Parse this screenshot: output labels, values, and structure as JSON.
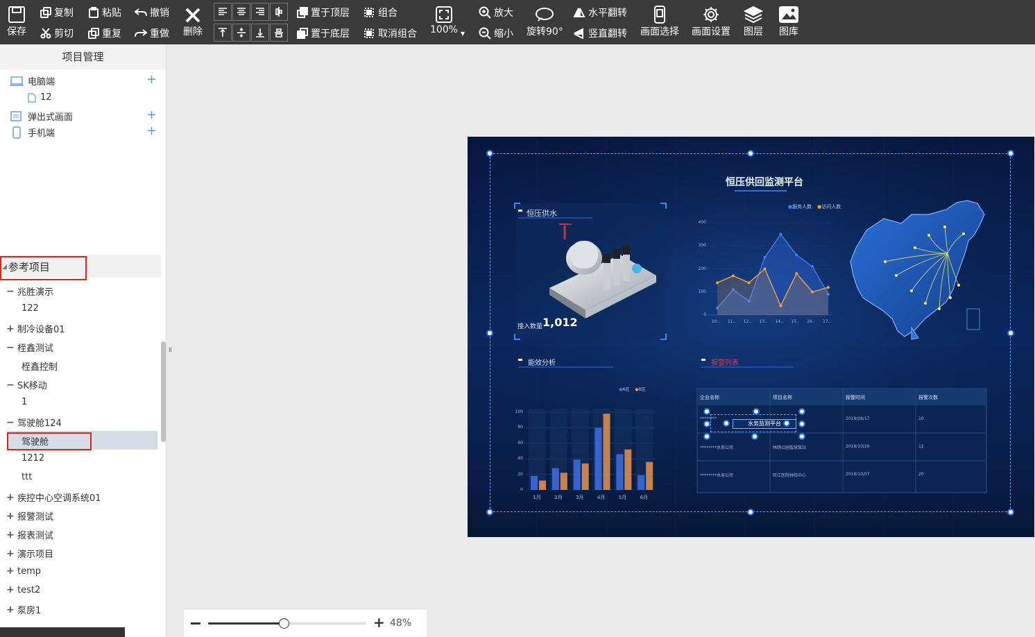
{
  "toolbar": {
    "save": "保存",
    "copy": "复制",
    "cut": "剪切",
    "paste": "粘贴",
    "repeat": "重复",
    "undo": "撤销",
    "redo": "重做",
    "delete": "删除",
    "bring_front": "置于顶层",
    "send_back": "置于底层",
    "group": "组合",
    "ungroup": "取消组合",
    "zoom_level": "100%",
    "zoom_in": "放大",
    "zoom_out": "缩小",
    "rotate": "旋转90°",
    "flip_h": "水平翻转",
    "flip_v": "竖直翻转",
    "screen_select": "画面选择",
    "screen_settings": "画面设置",
    "layers": "图层",
    "gallery": "图库"
  },
  "sidebar": {
    "title": "项目管理",
    "project_items": [
      {
        "label": "电脑端",
        "icon": "monitor-icon"
      },
      {
        "label": "12",
        "icon": "file-icon"
      },
      {
        "label": "弹出式画面",
        "icon": "popup-icon"
      },
      {
        "label": "手机端",
        "icon": "phone-icon"
      }
    ],
    "reference_header": "参考项目",
    "reference_items": [
      {
        "mark": "−",
        "label": "兆胜演示"
      },
      {
        "mark": "",
        "label": "122"
      },
      {
        "mark": "+",
        "label": "制冷设备01"
      },
      {
        "mark": "−",
        "label": "桎鑫测试"
      },
      {
        "mark": "",
        "label": "桎鑫控制"
      },
      {
        "mark": "−",
        "label": "SK移动"
      },
      {
        "mark": "",
        "label": "1"
      },
      {
        "mark": "−",
        "label": "驾驶舱124"
      },
      {
        "mark": "",
        "label": "驾驶舱"
      },
      {
        "mark": "",
        "label": "1212"
      },
      {
        "mark": "",
        "label": "ttt"
      },
      {
        "mark": "+",
        "label": "疾控中心空调系统01"
      },
      {
        "mark": "+",
        "label": "报警测试"
      },
      {
        "mark": "+",
        "label": "报表测试"
      },
      {
        "mark": "+",
        "label": "演示项目"
      },
      {
        "mark": "+",
        "label": "temp"
      },
      {
        "mark": "+",
        "label": "test2"
      },
      {
        "mark": "+",
        "label": "泵房1"
      }
    ]
  },
  "canvas": {
    "main_title": "恒压供回监测平台",
    "panel1_title": "恒压供水",
    "access_label": "接入数量",
    "access_value": "1,012",
    "line_legend": [
      "服务人数",
      "访问人数"
    ],
    "line_y_ticks": [
      "400",
      "300",
      "200",
      "100",
      "0"
    ],
    "line_x_ticks": [
      "10..",
      "11..",
      "12..",
      "13..",
      "14..",
      "15..",
      "16..",
      "17.."
    ],
    "panel3_title": "能效分析",
    "bar_legend": [
      "A区",
      "B区"
    ],
    "bar_y_ticks": [
      "100",
      "80",
      "60",
      "40",
      "20",
      "0"
    ],
    "bar_x_ticks": [
      "1月",
      "2月",
      "3月",
      "4月",
      "5月",
      "6月"
    ],
    "panel4_title": "报警列表",
    "table_headers": [
      "企业名称",
      "项目名称",
      "报警时间",
      "报警次数"
    ],
    "table_rows": [
      [
        "********",
        "水务监测平台",
        "2018/08/17",
        "10"
      ],
      [
        "********水务公司",
        "林荫公园智慧泵站",
        "2018/10/26",
        "12"
      ],
      [
        "********水务公司",
        "旺江医院林校中心",
        "2018/10/07",
        "20"
      ]
    ],
    "selected_text": "水务监测平台"
  },
  "zoom": {
    "percent": "48%",
    "value": 0.48
  },
  "chart_data": [
    {
      "type": "line",
      "x": [
        "10..",
        "11..",
        "12..",
        "13..",
        "14..",
        "15..",
        "16..",
        "17.."
      ],
      "series": [
        {
          "name": "服务人数",
          "values": [
            30,
            110,
            60,
            250,
            350,
            260,
            210,
            90
          ]
        },
        {
          "name": "访问人数",
          "values": [
            140,
            170,
            140,
            200,
            40,
            180,
            100,
            120
          ]
        }
      ],
      "ylim": [
        0,
        400
      ],
      "colors": [
        "#3b7bff",
        "#f2a23c"
      ]
    },
    {
      "type": "bar",
      "categories": [
        "1月",
        "2月",
        "3月",
        "4月",
        "5月",
        "6月"
      ],
      "series": [
        {
          "name": "A区",
          "values": [
            18,
            28,
            39,
            80,
            46,
            19
          ]
        },
        {
          "name": "B区",
          "values": [
            12,
            22,
            34,
            98,
            52,
            36
          ]
        }
      ],
      "ylim": [
        0,
        100
      ],
      "colors": [
        "#3b6fe6",
        "#e8924a"
      ]
    }
  ]
}
